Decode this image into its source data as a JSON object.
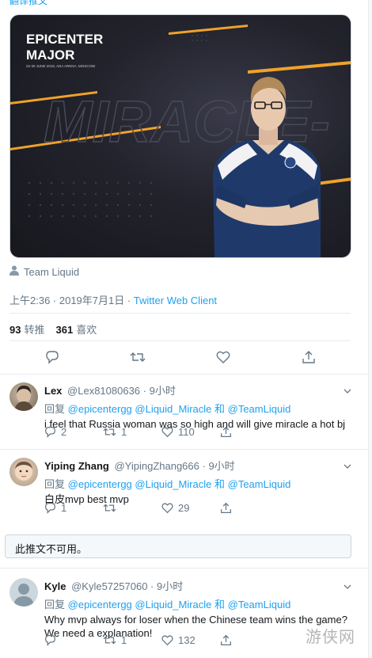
{
  "translate_link": "翻译推文",
  "media": {
    "event_title_line1": "EPICENTER",
    "event_title_line2": "MAJOR",
    "event_subtitle": "22-30 JUNE 2019, ADA ARENA, MOSCOW",
    "player_name": "MIRACLE-"
  },
  "tweet": {
    "author_label": "Team Liquid",
    "time": "上午2:36 · 2019年7月1日 · ",
    "client": "Twitter Web Client",
    "retweets_count": "93",
    "retweets_label": "转推",
    "likes_count": "361",
    "likes_label": "喜欢"
  },
  "replies": [
    {
      "name": "Lex",
      "handle": "@Lex81080636",
      "time": "· 9小时",
      "reply_prefix": "回复",
      "mentions": "@epicentergg @Liquid_Miracle 和 @TeamLiquid",
      "text": "i feel that Russia woman was so high and will give miracle a hot bj",
      "replies_count": "2",
      "retweets_count": "1",
      "likes_count": "110"
    },
    {
      "name": "Yiping Zhang",
      "handle": "@YipingZhang666",
      "time": "· 9小时",
      "reply_prefix": "回复",
      "mentions": "@epicentergg @Liquid_Miracle 和 @TeamLiquid",
      "text": "白皮mvp best mvp",
      "replies_count": "1",
      "retweets_count": "",
      "likes_count": "29"
    },
    {
      "name": "Kyle",
      "handle": "@Kyle57257060",
      "time": "· 9小时",
      "reply_prefix": "回复",
      "mentions": "@epicentergg @Liquid_Miracle 和 @TeamLiquid",
      "text": "Why mvp always for loser when the Chinese team wins the game? We need a explanation!",
      "replies_count": "",
      "retweets_count": "1",
      "likes_count": "132"
    }
  ],
  "unavailable_notice": "此推文不可用。",
  "watermark": "游侠网",
  "colors": {
    "link": "#1da1f2",
    "muted": "#657786",
    "border": "#e6ecf0"
  }
}
